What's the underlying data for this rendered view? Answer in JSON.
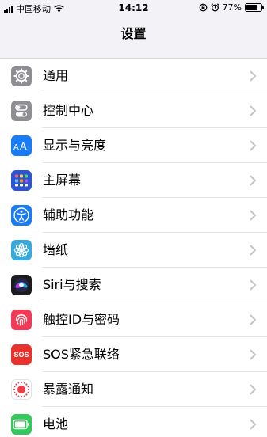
{
  "status_bar": {
    "carrier": "中国移动",
    "time": "14:12",
    "battery_percent": "77%",
    "battery_level": 0.77,
    "icons": [
      "signal-icon",
      "wifi-icon",
      "lock-rotation-icon",
      "alarm-icon",
      "battery-icon"
    ]
  },
  "nav": {
    "title": "设置"
  },
  "settings": [
    {
      "id": "general",
      "label": "通用",
      "icon": "gear-icon",
      "color": "#8e8e93"
    },
    {
      "id": "control-center",
      "label": "控制中心",
      "icon": "toggles-icon",
      "color": "#8e8e93"
    },
    {
      "id": "display",
      "label": "显示与亮度",
      "icon": "text-size-icon",
      "color": "#1a7cf5"
    },
    {
      "id": "home-screen",
      "label": "主屏幕",
      "icon": "app-grid-icon",
      "color": "#2c54d6"
    },
    {
      "id": "accessibility",
      "label": "辅助功能",
      "icon": "accessibility-icon",
      "color": "#1a7cf5"
    },
    {
      "id": "wallpaper",
      "label": "墙纸",
      "icon": "flower-icon",
      "color": "#36aadc"
    },
    {
      "id": "siri",
      "label": "Siri与搜索",
      "icon": "siri-icon",
      "color": "#1c1c1e"
    },
    {
      "id": "touch-id",
      "label": "触控ID与密码",
      "icon": "fingerprint-icon",
      "color": "#f23a56"
    },
    {
      "id": "sos",
      "label": "SOS紧急联络",
      "icon": "sos-icon",
      "icon_text": "SOS",
      "color": "#e8322b"
    },
    {
      "id": "exposure",
      "label": "暴露通知",
      "icon": "exposure-notification-icon",
      "color": "#ffffff"
    },
    {
      "id": "battery",
      "label": "电池",
      "icon": "battery-icon",
      "color": "#34c759"
    }
  ]
}
